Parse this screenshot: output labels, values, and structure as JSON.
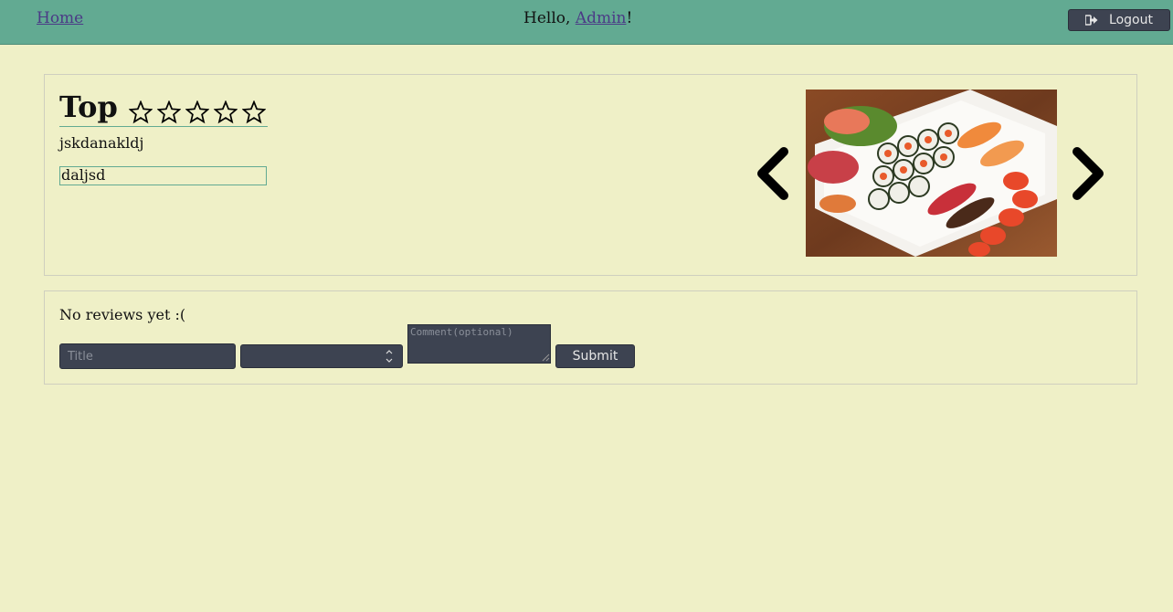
{
  "nav": {
    "home_label": "Home",
    "greeting_prefix": "Hello, ",
    "user_name": "Admin",
    "greeting_suffix": "!",
    "logout_label": "Logout"
  },
  "item": {
    "title": "Top",
    "rating_stars_filled": 0,
    "rating_stars_total": 5,
    "description": "jskdanakldj",
    "field_value": "daljsd",
    "photo_icon": "sushi-platter-photo"
  },
  "reviews": {
    "empty_message": "No reviews yet :(",
    "title_placeholder": "Title",
    "rating_value": "",
    "comment_placeholder": "Comment(optional)",
    "submit_label": "Submit"
  },
  "colors": {
    "background": "#eff0c7",
    "topbar": "#62aa92",
    "dark_control": "#3d4351",
    "link": "#4b3a86"
  }
}
